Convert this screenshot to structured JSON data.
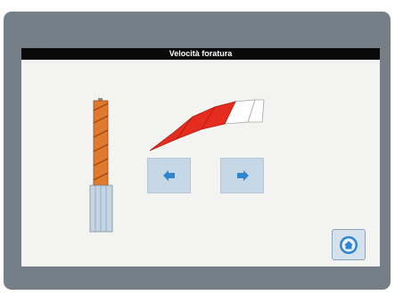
{
  "screen": {
    "title": "Velocità foratura",
    "speed_level": {
      "filled_segments": 3,
      "total_segments": 5
    }
  },
  "controls": {
    "decrease_icon": "arrow-left-icon",
    "increase_icon": "arrow-right-icon",
    "home_icon": "home-icon"
  },
  "colors": {
    "bezel": "#747f87",
    "screen_bg": "#f3f3f1",
    "title_bar": "#0a0a0a",
    "gauge_active": "#e52d1f",
    "drill_flute": "#e0782d",
    "button_bg": "#c6d7e6",
    "arrow": "#2f86cf"
  }
}
